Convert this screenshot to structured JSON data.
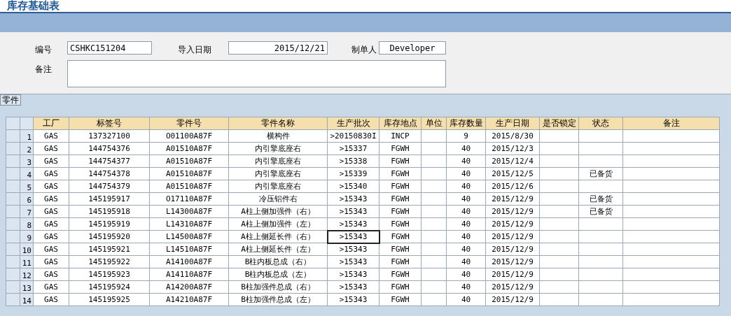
{
  "title": "库存基础表",
  "form": {
    "code_label": "编号",
    "code_value": "CSHKC151204",
    "date_label": "导入日期",
    "date_value": "2015/12/21",
    "creator_label": "制单人",
    "creator_value": "Developer",
    "remarks_label": "备注"
  },
  "tabs": [
    {
      "label": "零件",
      "selected": true
    }
  ],
  "table": {
    "columns": [
      "工厂",
      "标签号",
      "零件号",
      "零件名称",
      "生产批次",
      "库存地点",
      "单位",
      "库存数量",
      "生产日期",
      "是否锁定",
      "状态",
      "备注"
    ],
    "rows": [
      {
        "number": "1",
        "plant": "GAS",
        "label_no": "137327100",
        "part_no": "O01100A87F",
        "part_name": "横构件",
        "batch": ">20150830I",
        "location": "INCP",
        "qty": "9",
        "date": "2015/8/30",
        "batch_focused": false
      },
      {
        "number": "2",
        "plant": "GAS",
        "label_no": "144754376",
        "part_no": "A01510A87F",
        "part_name": "内引擎底座右",
        "batch": ">15337",
        "location": "FGWH",
        "qty": "40",
        "date": "2015/12/3",
        "batch_focused": false
      },
      {
        "number": "3",
        "plant": "GAS",
        "label_no": "144754377",
        "part_no": "A01510A87F",
        "part_name": "内引擎底座右",
        "batch": ">15338",
        "location": "FGWH",
        "qty": "40",
        "date": "2015/12/4",
        "batch_focused": false
      },
      {
        "number": "4",
        "plant": "GAS",
        "label_no": "144754378",
        "part_no": "A01510A87F",
        "part_name": "内引擎底座右",
        "batch": ">15339",
        "location": "FGWH",
        "qty": "40",
        "date": "2015/12/5",
        "status": "已备货",
        "batch_focused": false
      },
      {
        "number": "5",
        "plant": "GAS",
        "label_no": "144754379",
        "part_no": "A01510A87F",
        "part_name": "内引擎底座右",
        "batch": ">15340",
        "location": "FGWH",
        "qty": "40",
        "date": "2015/12/6",
        "batch_focused": false
      },
      {
        "number": "6",
        "plant": "GAS",
        "label_no": "145195917",
        "part_no": "O17110A87F",
        "part_name": "冷压铝件右",
        "batch": ">15343",
        "location": "FGWH",
        "qty": "40",
        "date": "2015/12/9",
        "status": "已备货",
        "batch_focused": false
      },
      {
        "number": "7",
        "plant": "GAS",
        "label_no": "145195918",
        "part_no": "L14300A87F",
        "part_name": "A柱上侧加强件（右）",
        "batch": ">15343",
        "location": "FGWH",
        "qty": "40",
        "date": "2015/12/9",
        "status": "已备货",
        "batch_focused": false
      },
      {
        "number": "8",
        "plant": "GAS",
        "label_no": "145195919",
        "part_no": "L14310A87F",
        "part_name": "A柱上侧加强件（左）",
        "batch": ">15343",
        "location": "FGWH",
        "qty": "40",
        "date": "2015/12/9",
        "batch_focused": false
      },
      {
        "number": "9",
        "plant": "GAS",
        "label_no": "145195920",
        "part_no": "L14500A87F",
        "part_name": "A柱上侧延长件（右）",
        "batch": ">15343",
        "location": "FGWH",
        "qty": "40",
        "date": "2015/12/9",
        "batch_focused": true
      },
      {
        "number": "10",
        "plant": "GAS",
        "label_no": "145195921",
        "part_no": "L14510A87F",
        "part_name": "A柱上侧延长件（左）",
        "batch": ">15343",
        "location": "FGWH",
        "qty": "40",
        "date": "2015/12/9",
        "batch_focused": false
      },
      {
        "number": "11",
        "plant": "GAS",
        "label_no": "145195922",
        "part_no": "A14100A87F",
        "part_name": "B柱内板总成（右）",
        "batch": ">15343",
        "location": "FGWH",
        "qty": "40",
        "date": "2015/12/9",
        "batch_focused": false
      },
      {
        "number": "12",
        "plant": "GAS",
        "label_no": "145195923",
        "part_no": "A14110A87F",
        "part_name": "B柱内板总成（左）",
        "batch": ">15343",
        "location": "FGWH",
        "qty": "40",
        "date": "2015/12/9",
        "batch_focused": false
      },
      {
        "number": "13",
        "plant": "GAS",
        "label_no": "145195924",
        "part_no": "A14200A87F",
        "part_name": "B柱加强件总成（右）",
        "batch": ">15343",
        "location": "FGWH",
        "qty": "40",
        "date": "2015/12/9",
        "batch_focused": false
      },
      {
        "number": "14",
        "plant": "GAS",
        "label_no": "145195925",
        "part_no": "A14210A87F",
        "part_name": "B柱加强件总成（左）",
        "batch": ">15343",
        "location": "FGWH",
        "qty": "40",
        "date": "2015/12/9",
        "batch_focused": false
      }
    ]
  }
}
